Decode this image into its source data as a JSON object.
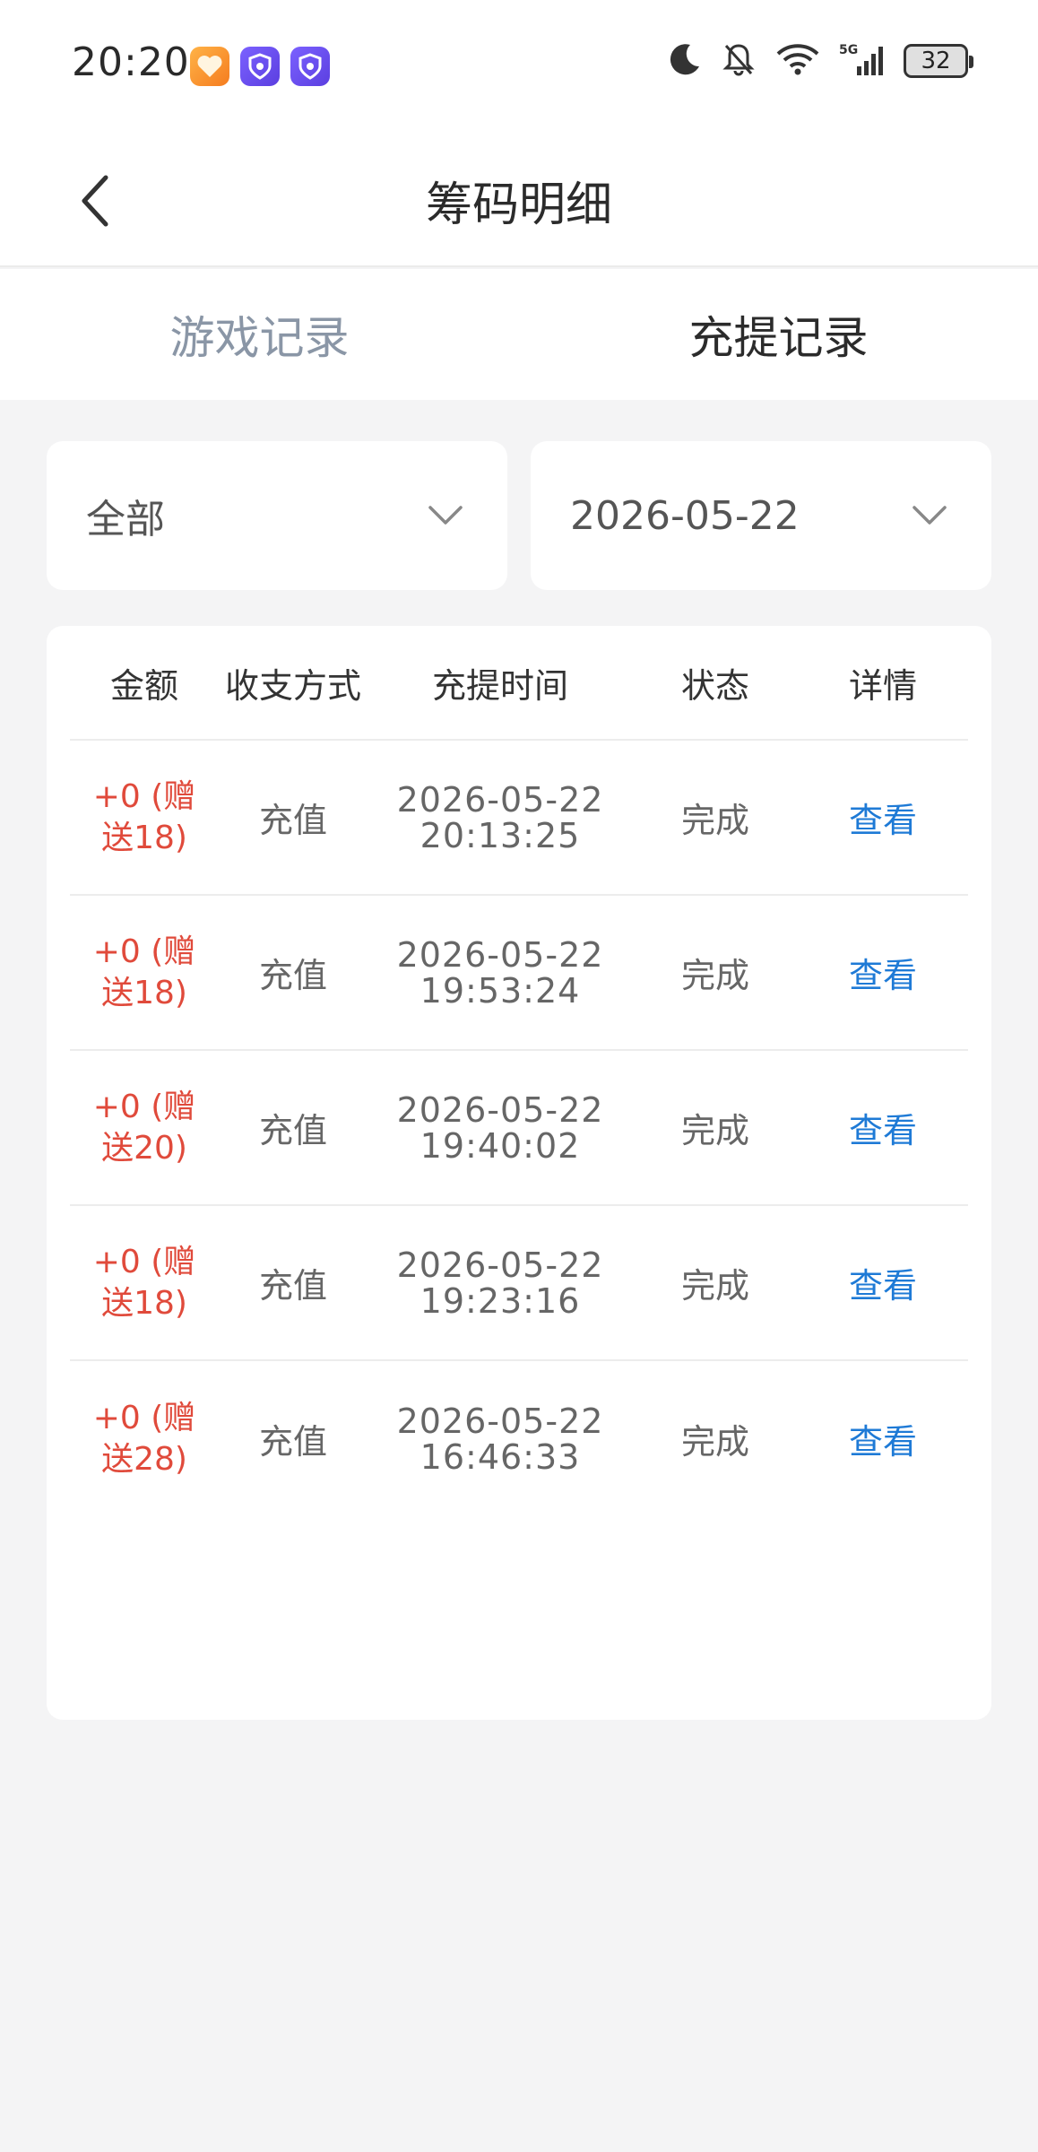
{
  "status_bar": {
    "time": "20:20",
    "battery": "32",
    "icons": [
      "heart-app-icon",
      "shield-app-icon",
      "shield-app-icon",
      "moon-icon",
      "bell-off-icon",
      "wifi-icon",
      "signal-5g-icon",
      "battery-icon"
    ]
  },
  "header": {
    "title": "筹码明细",
    "back_icon": "chevron-left-icon"
  },
  "tabs": [
    {
      "label": "游戏记录",
      "active": false
    },
    {
      "label": "充提记录",
      "active": true
    }
  ],
  "filters": {
    "type": {
      "value": "全部",
      "icon": "chevron-down-icon"
    },
    "date": {
      "value": "2026-05-22",
      "icon": "chevron-down-icon"
    }
  },
  "table": {
    "headers": [
      "金额",
      "收支方式",
      "充提时间",
      "状态",
      "详情"
    ],
    "rows": [
      {
        "amount_line1": "+0 (赠",
        "amount_line2": "送18)",
        "method": "充值",
        "date": "2026-05-22",
        "time": "20:13:25",
        "status": "完成",
        "detail": "查看"
      },
      {
        "amount_line1": "+0 (赠",
        "amount_line2": "送18)",
        "method": "充值",
        "date": "2026-05-22",
        "time": "19:53:24",
        "status": "完成",
        "detail": "查看"
      },
      {
        "amount_line1": "+0 (赠",
        "amount_line2": "送20)",
        "method": "充值",
        "date": "2026-05-22",
        "time": "19:40:02",
        "status": "完成",
        "detail": "查看"
      },
      {
        "amount_line1": "+0 (赠",
        "amount_line2": "送18)",
        "method": "充值",
        "date": "2026-05-22",
        "time": "19:23:16",
        "status": "完成",
        "detail": "查看"
      },
      {
        "amount_line1": "+0 (赠",
        "amount_line2": "送28)",
        "method": "充值",
        "date": "2026-05-22",
        "time": "16:46:33",
        "status": "完成",
        "detail": "查看"
      }
    ]
  },
  "colors": {
    "amount": "#e04a3b",
    "link": "#1e7ad6",
    "tab_inactive": "#8a96a6",
    "background": "#f4f4f5"
  }
}
